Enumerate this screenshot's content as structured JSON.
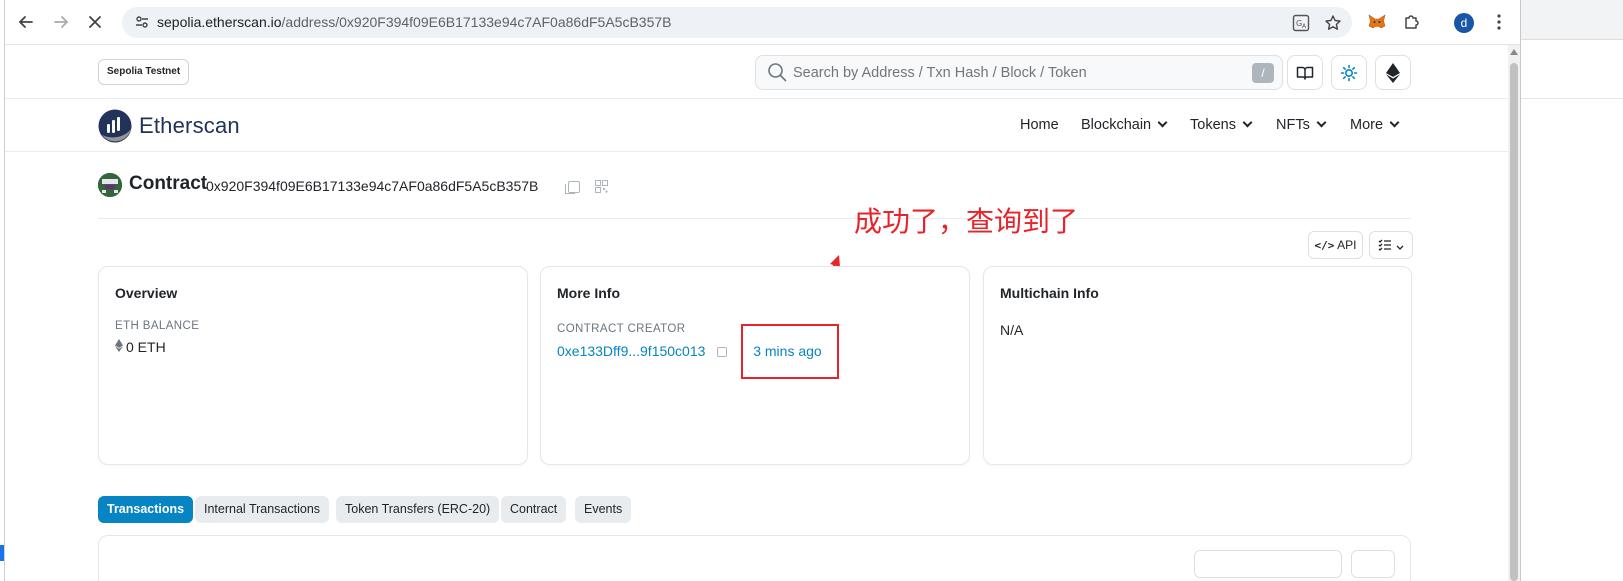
{
  "browser": {
    "url_host": "sepolia.etherscan.io",
    "url_path": "/address/0x920F394f09E6B17133e94c7AF0a86dF5A5cB357B",
    "profile_initial": "d"
  },
  "topbar": {
    "network_badge": "Sepolia Testnet",
    "search_placeholder": "Search by Address / Txn Hash / Block / Token",
    "search_shortcut": "/"
  },
  "header": {
    "brand": "Etherscan",
    "menu": [
      {
        "label": "Home"
      },
      {
        "label": "Blockchain"
      },
      {
        "label": "Tokens"
      },
      {
        "label": "NFTs"
      },
      {
        "label": "More"
      }
    ]
  },
  "contract": {
    "label": "Contract",
    "address": "0x920F394f09E6B17133e94c7AF0a86dF5A5cB357B"
  },
  "annotation": {
    "text": "成功了，查询到了",
    "color": "#e8232a"
  },
  "actions": {
    "api_label": "API"
  },
  "cards": {
    "overview": {
      "title": "Overview",
      "balance_label": "ETH BALANCE",
      "balance_value": "0 ETH"
    },
    "more_info": {
      "title": "More Info",
      "creator_label": "CONTRACT CREATOR",
      "creator_address": "0xe133Dff9...9f150c013",
      "separator": "|",
      "created_ago": "3 mins ago"
    },
    "multichain": {
      "title": "Multichain Info",
      "value": "N/A"
    }
  },
  "tabs": [
    {
      "label": "Transactions",
      "active": true
    },
    {
      "label": "Internal Transactions",
      "active": false
    },
    {
      "label": "Token Transfers (ERC-20)",
      "active": false
    },
    {
      "label": "Contract",
      "active": false
    },
    {
      "label": "Events",
      "active": false
    }
  ],
  "colors": {
    "accent": "#0784c3",
    "brand_dark": "#21325b"
  }
}
